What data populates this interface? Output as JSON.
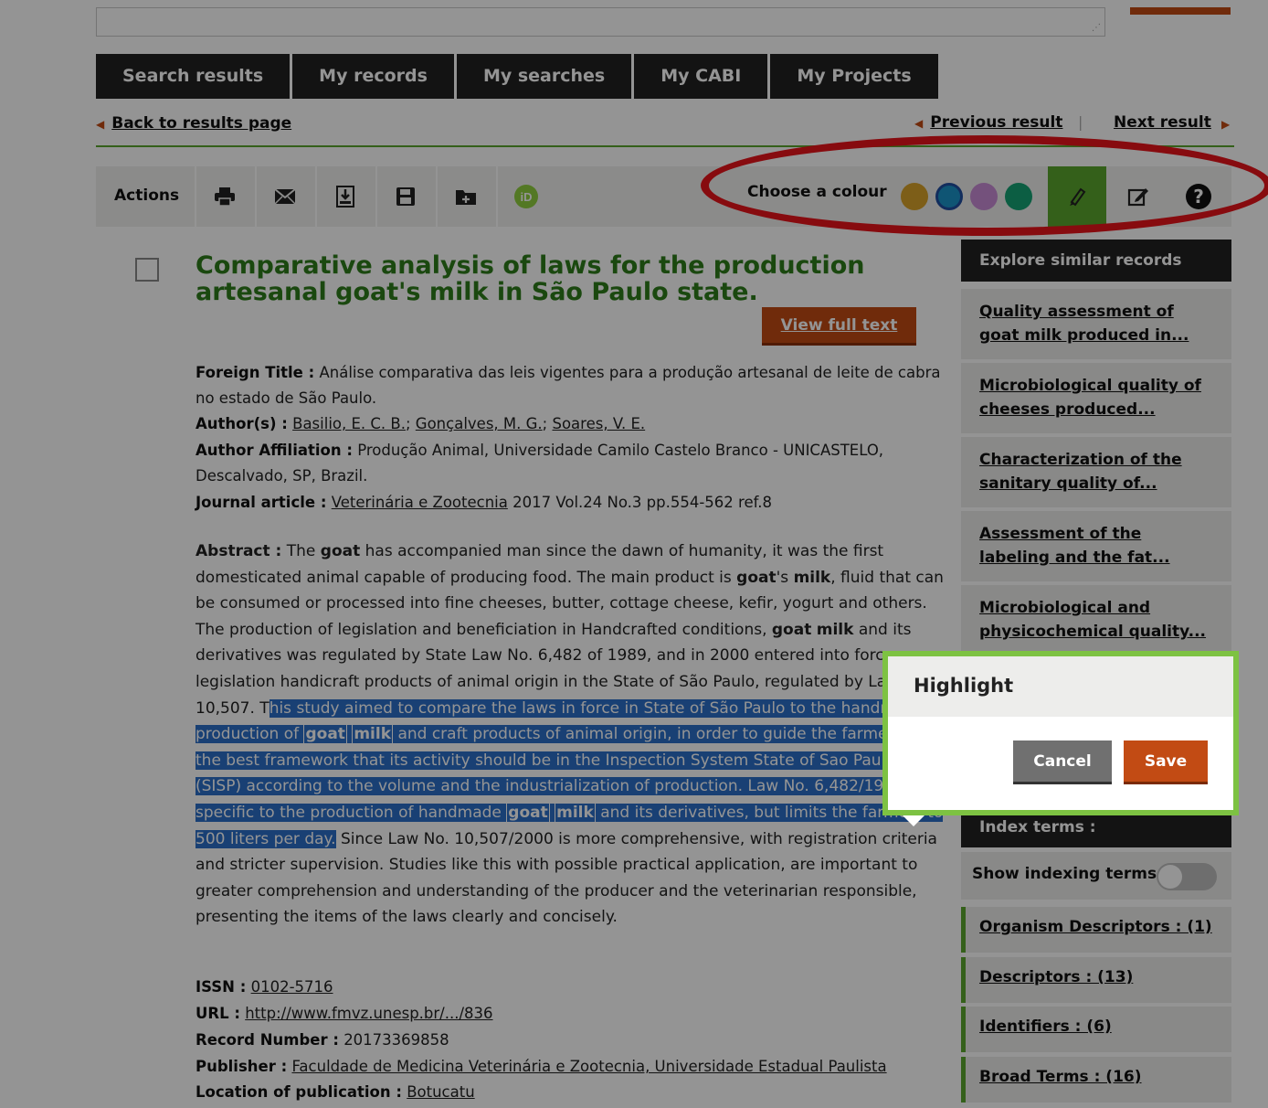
{
  "tabs": [
    "Search results",
    "My records",
    "My searches",
    "My CABI",
    "My Projects"
  ],
  "nav": {
    "back": "Back to results page",
    "previous": "Previous result",
    "separator": "|",
    "next": "Next result"
  },
  "actions": {
    "label": "Actions",
    "icons": [
      "print-icon",
      "email-icon",
      "download-icon",
      "save-icon",
      "add-to-folder-icon",
      "orcid-icon"
    ],
    "colour_label": "Choose a colour",
    "colours": [
      "#d8a32a",
      "#1a93c9",
      "#c98cd6",
      "#16a374"
    ],
    "selected_colour": "#1a93c9",
    "help_glyph": "?"
  },
  "record": {
    "title": "Comparative analysis of laws for the production artesanal goat's milk in São Paulo state.",
    "full_text_button": "View full text",
    "foreign_title_label": "Foreign Title :",
    "foreign_title": "Análise comparativa das leis vigentes para a produção artesanal de leite de cabra no estado de São Paulo.",
    "authors_label": "Author(s) :",
    "authors": [
      "Basilio, E. C. B.",
      "Gonçalves, M. G.",
      "Soares, V. E."
    ],
    "author_sep": ";",
    "affiliation_label": "Author Affiliation :",
    "affiliation": "Produção Animal, Universidade Camilo Castelo Branco - UNICASTELO, Descalvado, SP, Brazil.",
    "journal_label": "Journal article :",
    "journal": "Veterinária e Zootecnia",
    "journal_details": "2017 Vol.24 No.3 pp.554-562 ref.8",
    "abstract_label": "Abstract :",
    "abstract_parts": {
      "p1": "The",
      "k_goat": "goat",
      "p2": "has accompanied man since the dawn of humanity, it was the first domesticated animal capable of producing food. The main product is",
      "p3": "'s",
      "k_milk": "milk",
      "p4": ", fluid that can be consumed or processed into fine cheeses, butter, cottage cheese, kefir, yogurt and others. The production of legislation and beneficiation in Handcrafted conditions,",
      "p5": "and its derivatives was regulated by State Law No. 6,482 of 1989, and in 2000 entered into force legislation handicraft products of animal origin in the State of São Paulo, regulated by Law No. 10,507. T",
      "s1": "his study aimed to compare the laws in force in State of São Paulo to the handmade production of",
      "s2": "and craft products of animal origin, in order to guide the farmers on the best framework that its activity should be in the Inspection System State of Sao Paulo (SISP) according to the volume and the industrialization of production. Law No. 6,482/1989 is specific to the production of handmade",
      "s3": "and its derivatives, but limits the farmers to 500 liters per day.",
      "p6": "Since Law No. 10,507/2000 is more comprehensive, with registration criteria and stricter supervision. Studies like this with possible practical application, are important to greater comprehension and understanding of the producer and the veterinarian responsible, presenting the items of the laws clearly and concisely."
    },
    "issn_label": "ISSN :",
    "issn": "0102-5716",
    "url_label": "URL :",
    "url": "http://www.fmvz.unesp.br/.../836",
    "record_number_label": "Record Number :",
    "record_number": "20173369858",
    "publisher_label": "Publisher :",
    "publisher": "Faculdade de Medicina Veterinária e Zootecnia, Universidade Estadual Paulista",
    "location_label": "Location of publication :",
    "location": "Botucatu"
  },
  "sidebar": {
    "explore_title": "Explore similar records",
    "similar": [
      "Quality assessment of goat milk produced in...",
      "Microbiological quality of cheeses produced...",
      "Characterization of the sanitary quality of...",
      "Assessment of the labeling and the fat...",
      "Microbiological and physicochemical quality..."
    ],
    "index_terms_title": "Index terms :",
    "show_indexing_label": "Show indexing terms:",
    "terms": [
      "Organism Descriptors : (1)",
      "Descriptors : (13)",
      "Identifiers : (6)",
      "Broad Terms : (16)"
    ]
  },
  "popup": {
    "title": "Highlight",
    "cancel": "Cancel",
    "save": "Save"
  }
}
